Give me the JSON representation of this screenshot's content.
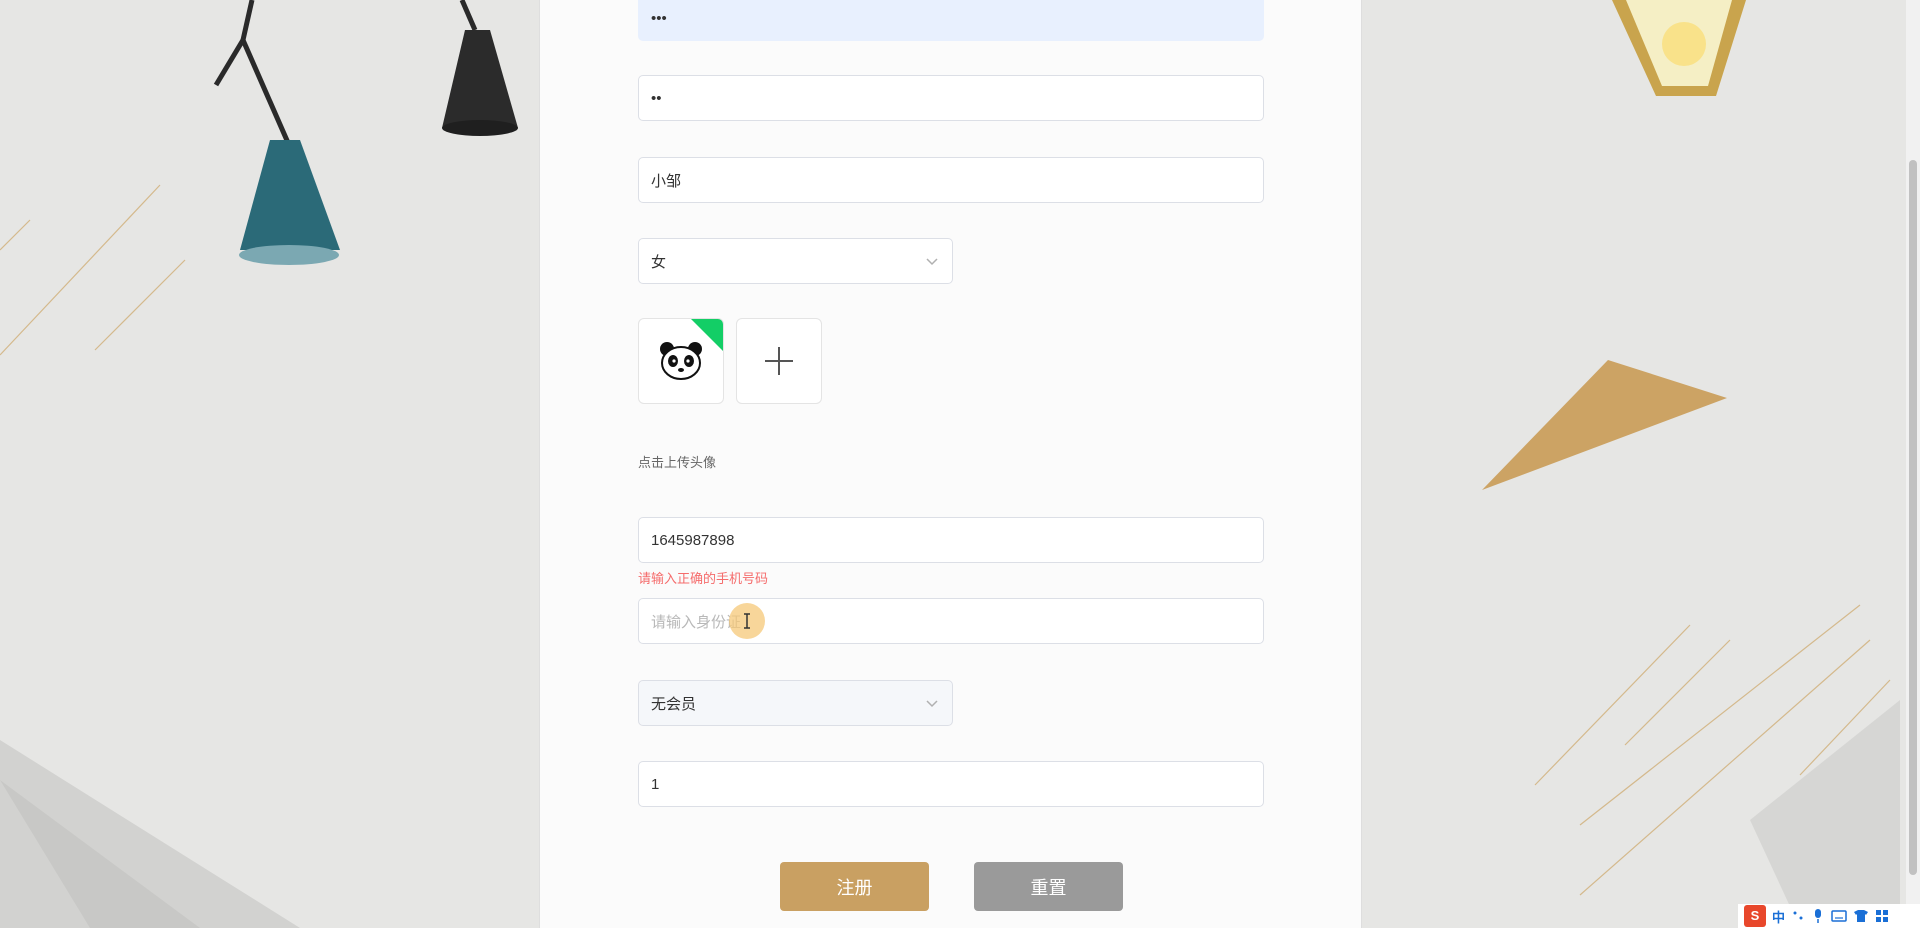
{
  "form": {
    "password_value": "•••",
    "confirm_password_value": "••",
    "nickname_value": "小邹",
    "gender_value": "女",
    "avatar_hint": "点击上传头像",
    "phone_value": "1645987898",
    "phone_error": "请输入正确的手机号码",
    "id_card_placeholder": "请输入身份证",
    "membership_value": "无会员",
    "extra_value": "1"
  },
  "buttons": {
    "register_label": "注册",
    "reset_label": "重置"
  },
  "ime": {
    "logo": "S",
    "mode": "中"
  },
  "colors": {
    "accent": "#c9a062",
    "reset": "#9a9a9a",
    "error": "#f56c6c",
    "autofill": "#e8f0fe"
  }
}
